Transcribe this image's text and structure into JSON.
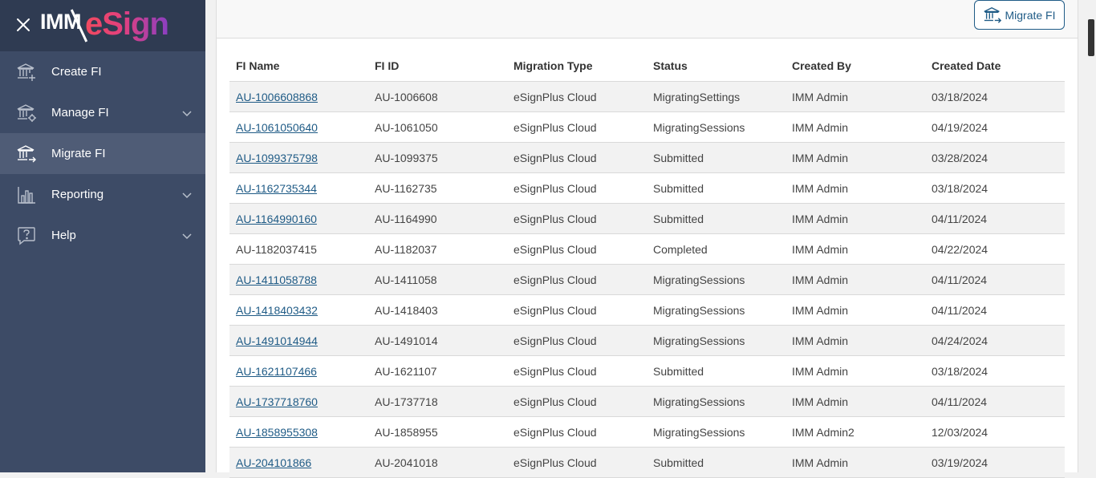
{
  "brand": {
    "imm": "IMM",
    "esign": "eSign"
  },
  "sidebar": {
    "items": [
      {
        "label": "Create FI",
        "icon": "bank-plus-icon",
        "active": false,
        "chevron": false
      },
      {
        "label": "Manage FI",
        "icon": "bank-gear-icon",
        "active": false,
        "chevron": true
      },
      {
        "label": "Migrate FI",
        "icon": "bank-arrow-icon",
        "active": true,
        "chevron": false
      },
      {
        "label": "Reporting",
        "icon": "bar-chart-icon",
        "active": false,
        "chevron": true
      },
      {
        "label": "Help",
        "icon": "help-bubble-icon",
        "active": false,
        "chevron": true
      }
    ]
  },
  "toolbar": {
    "migrate_label": "Migrate FI"
  },
  "table": {
    "headers": [
      "FI Name",
      "FI ID",
      "Migration Type",
      "Status",
      "Created By",
      "Created Date"
    ],
    "rows": [
      {
        "name": "AU-1006608868",
        "link": true,
        "id": "AU-1006608",
        "type": "eSignPlus Cloud",
        "status": "MigratingSettings",
        "by": "IMM Admin",
        "date": "03/18/2024"
      },
      {
        "name": "AU-1061050640",
        "link": true,
        "id": "AU-1061050",
        "type": "eSignPlus Cloud",
        "status": "MigratingSessions",
        "by": "IMM Admin",
        "date": "04/19/2024"
      },
      {
        "name": "AU-1099375798",
        "link": true,
        "id": "AU-1099375",
        "type": "eSignPlus Cloud",
        "status": "Submitted",
        "by": "IMM Admin",
        "date": "03/28/2024"
      },
      {
        "name": "AU-1162735344",
        "link": true,
        "id": "AU-1162735",
        "type": "eSignPlus Cloud",
        "status": "Submitted",
        "by": "IMM Admin",
        "date": "03/18/2024"
      },
      {
        "name": "AU-1164990160",
        "link": true,
        "id": "AU-1164990",
        "type": "eSignPlus Cloud",
        "status": "Submitted",
        "by": "IMM Admin",
        "date": "04/11/2024"
      },
      {
        "name": "AU-1182037415",
        "link": false,
        "id": "AU-1182037",
        "type": "eSignPlus Cloud",
        "status": "Completed",
        "by": "IMM Admin",
        "date": "04/22/2024"
      },
      {
        "name": "AU-1411058788",
        "link": true,
        "id": "AU-1411058",
        "type": "eSignPlus Cloud",
        "status": "MigratingSessions",
        "by": "IMM Admin",
        "date": "04/11/2024"
      },
      {
        "name": "AU-1418403432",
        "link": true,
        "id": "AU-1418403",
        "type": "eSignPlus Cloud",
        "status": "MigratingSessions",
        "by": "IMM Admin",
        "date": "04/11/2024"
      },
      {
        "name": "AU-1491014944",
        "link": true,
        "id": "AU-1491014",
        "type": "eSignPlus Cloud",
        "status": "MigratingSessions",
        "by": "IMM Admin",
        "date": "04/24/2024"
      },
      {
        "name": "AU-1621107466",
        "link": true,
        "id": "AU-1621107",
        "type": "eSignPlus Cloud",
        "status": "Submitted",
        "by": "IMM Admin",
        "date": "03/18/2024"
      },
      {
        "name": "AU-1737718760",
        "link": true,
        "id": "AU-1737718",
        "type": "eSignPlus Cloud",
        "status": "MigratingSessions",
        "by": "IMM Admin",
        "date": "04/11/2024"
      },
      {
        "name": "AU-1858955308",
        "link": true,
        "id": "AU-1858955",
        "type": "eSignPlus Cloud",
        "status": "MigratingSessions",
        "by": "IMM Admin2",
        "date": "12/03/2024"
      },
      {
        "name": "AU-204101866",
        "link": true,
        "id": "AU-2041018",
        "type": "eSignPlus Cloud",
        "status": "Submitted",
        "by": "IMM Admin",
        "date": "03/19/2024"
      }
    ]
  },
  "colors": {
    "sidebar": "#3d4b66",
    "sidebar_header": "#2f3b52",
    "active": "#4f5c76",
    "link": "#1f5b86"
  }
}
